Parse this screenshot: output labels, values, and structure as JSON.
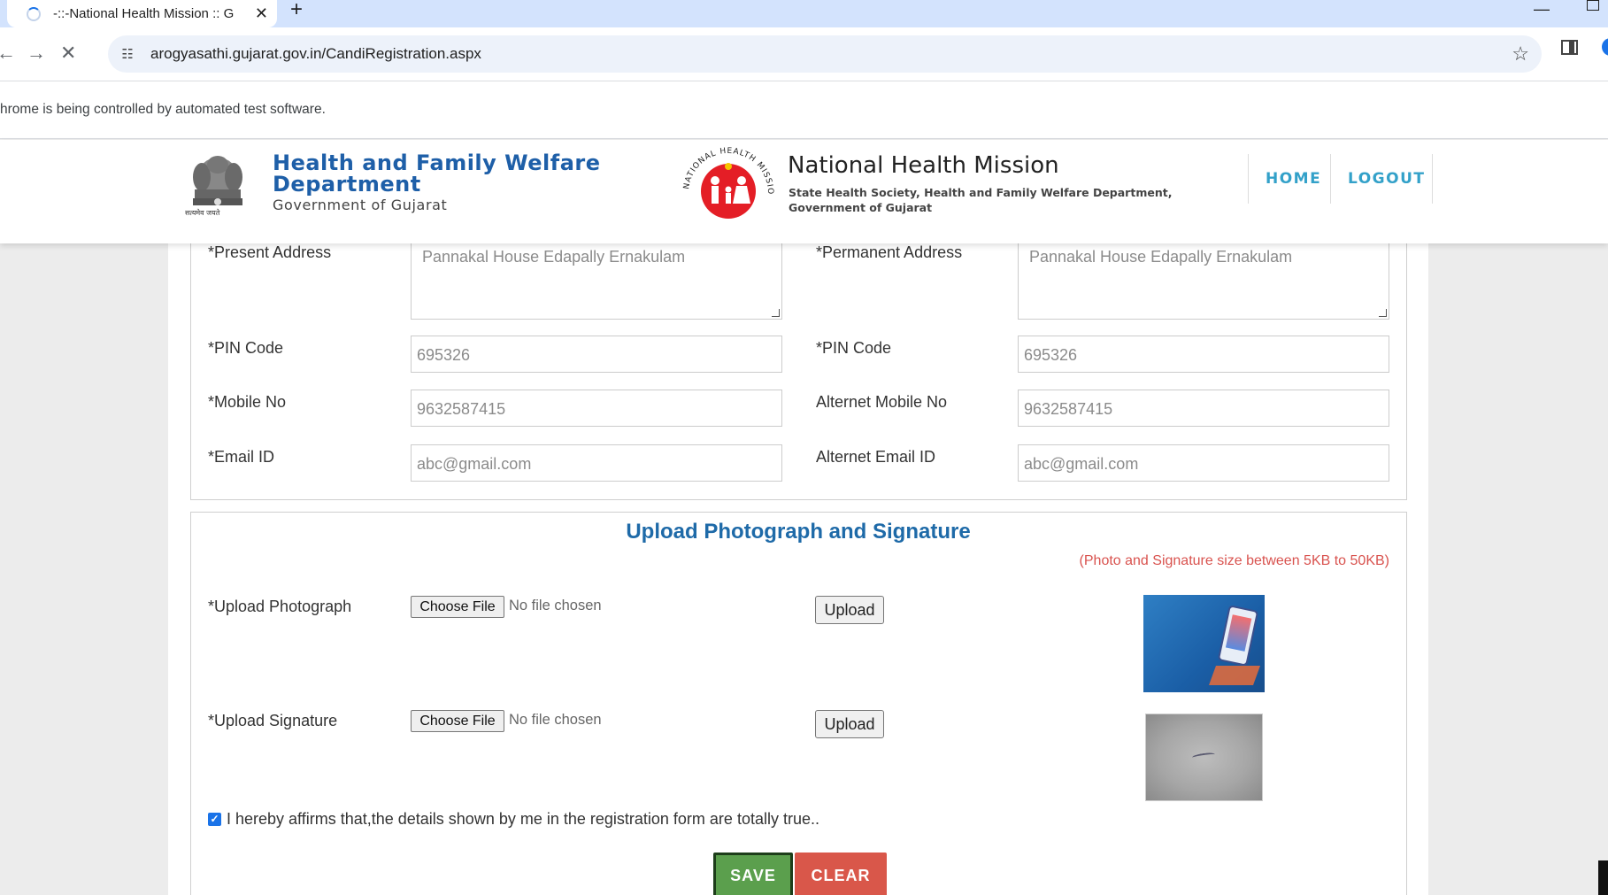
{
  "browser": {
    "tab_title": "-::-National Health Mission :: G",
    "tab_close": "✕",
    "new_tab": "+",
    "url": "arogyasathi.gujarat.gov.in/CandiRegistration.aspx",
    "infobar": "hrome is being controlled by automated test software."
  },
  "header": {
    "dept_title_line1": "Health and Family Welfare",
    "dept_title_line2": "Department",
    "dept_subtitle": "Government of Gujarat",
    "emblem_motto": "सत्यमेव जयते",
    "nhm_logo_text": "NATIONAL HEALTH MISSION",
    "nhm_title": "National Health Mission",
    "nhm_sub_line1": "State Health Society, Health and Family Welfare Department,",
    "nhm_sub_line2": "Government of Gujarat",
    "nav": {
      "home": "HOME",
      "logout": "LOGOUT"
    }
  },
  "form": {
    "present_address_label": "*Present Address",
    "present_address_value": "Pannakal House Edapally Ernakulam",
    "permanent_address_label": "*Permanent Address",
    "permanent_address_value": "Pannakal House Edapally Ernakulam",
    "pin_label": "*PIN Code",
    "pin_value": "695326",
    "pin2_label": "*PIN Code",
    "pin2_value": "695326",
    "mobile_label": "*Mobile No",
    "mobile_value": "9632587415",
    "alt_mobile_label": "Alternet Mobile No",
    "alt_mobile_value": "9632587415",
    "email_label": "*Email ID",
    "email_value": "abc@gmail.com",
    "alt_email_label": "Alternet Email ID",
    "alt_email_value": "abc@gmail.com"
  },
  "upload": {
    "title": "Upload Photograph and Signature",
    "size_note": "(Photo and Signature size between 5KB to 50KB)",
    "photo_label": "*Upload Photograph",
    "signature_label": "*Upload Signature",
    "choose_file": "Choose File",
    "no_file": "No file chosen",
    "upload_button": "Upload",
    "affirm_text": "I hereby affirms that,the details shown by me in the registration form are totally true..",
    "affirm_checked": true,
    "save": "SAVE",
    "clear": "CLEAR"
  },
  "colors": {
    "save_bg": "#5b9f4d",
    "clear_bg": "#d9574a",
    "section_title": "#1e6aa8",
    "note": "#d9534f",
    "nav_link": "#33a1c9"
  }
}
